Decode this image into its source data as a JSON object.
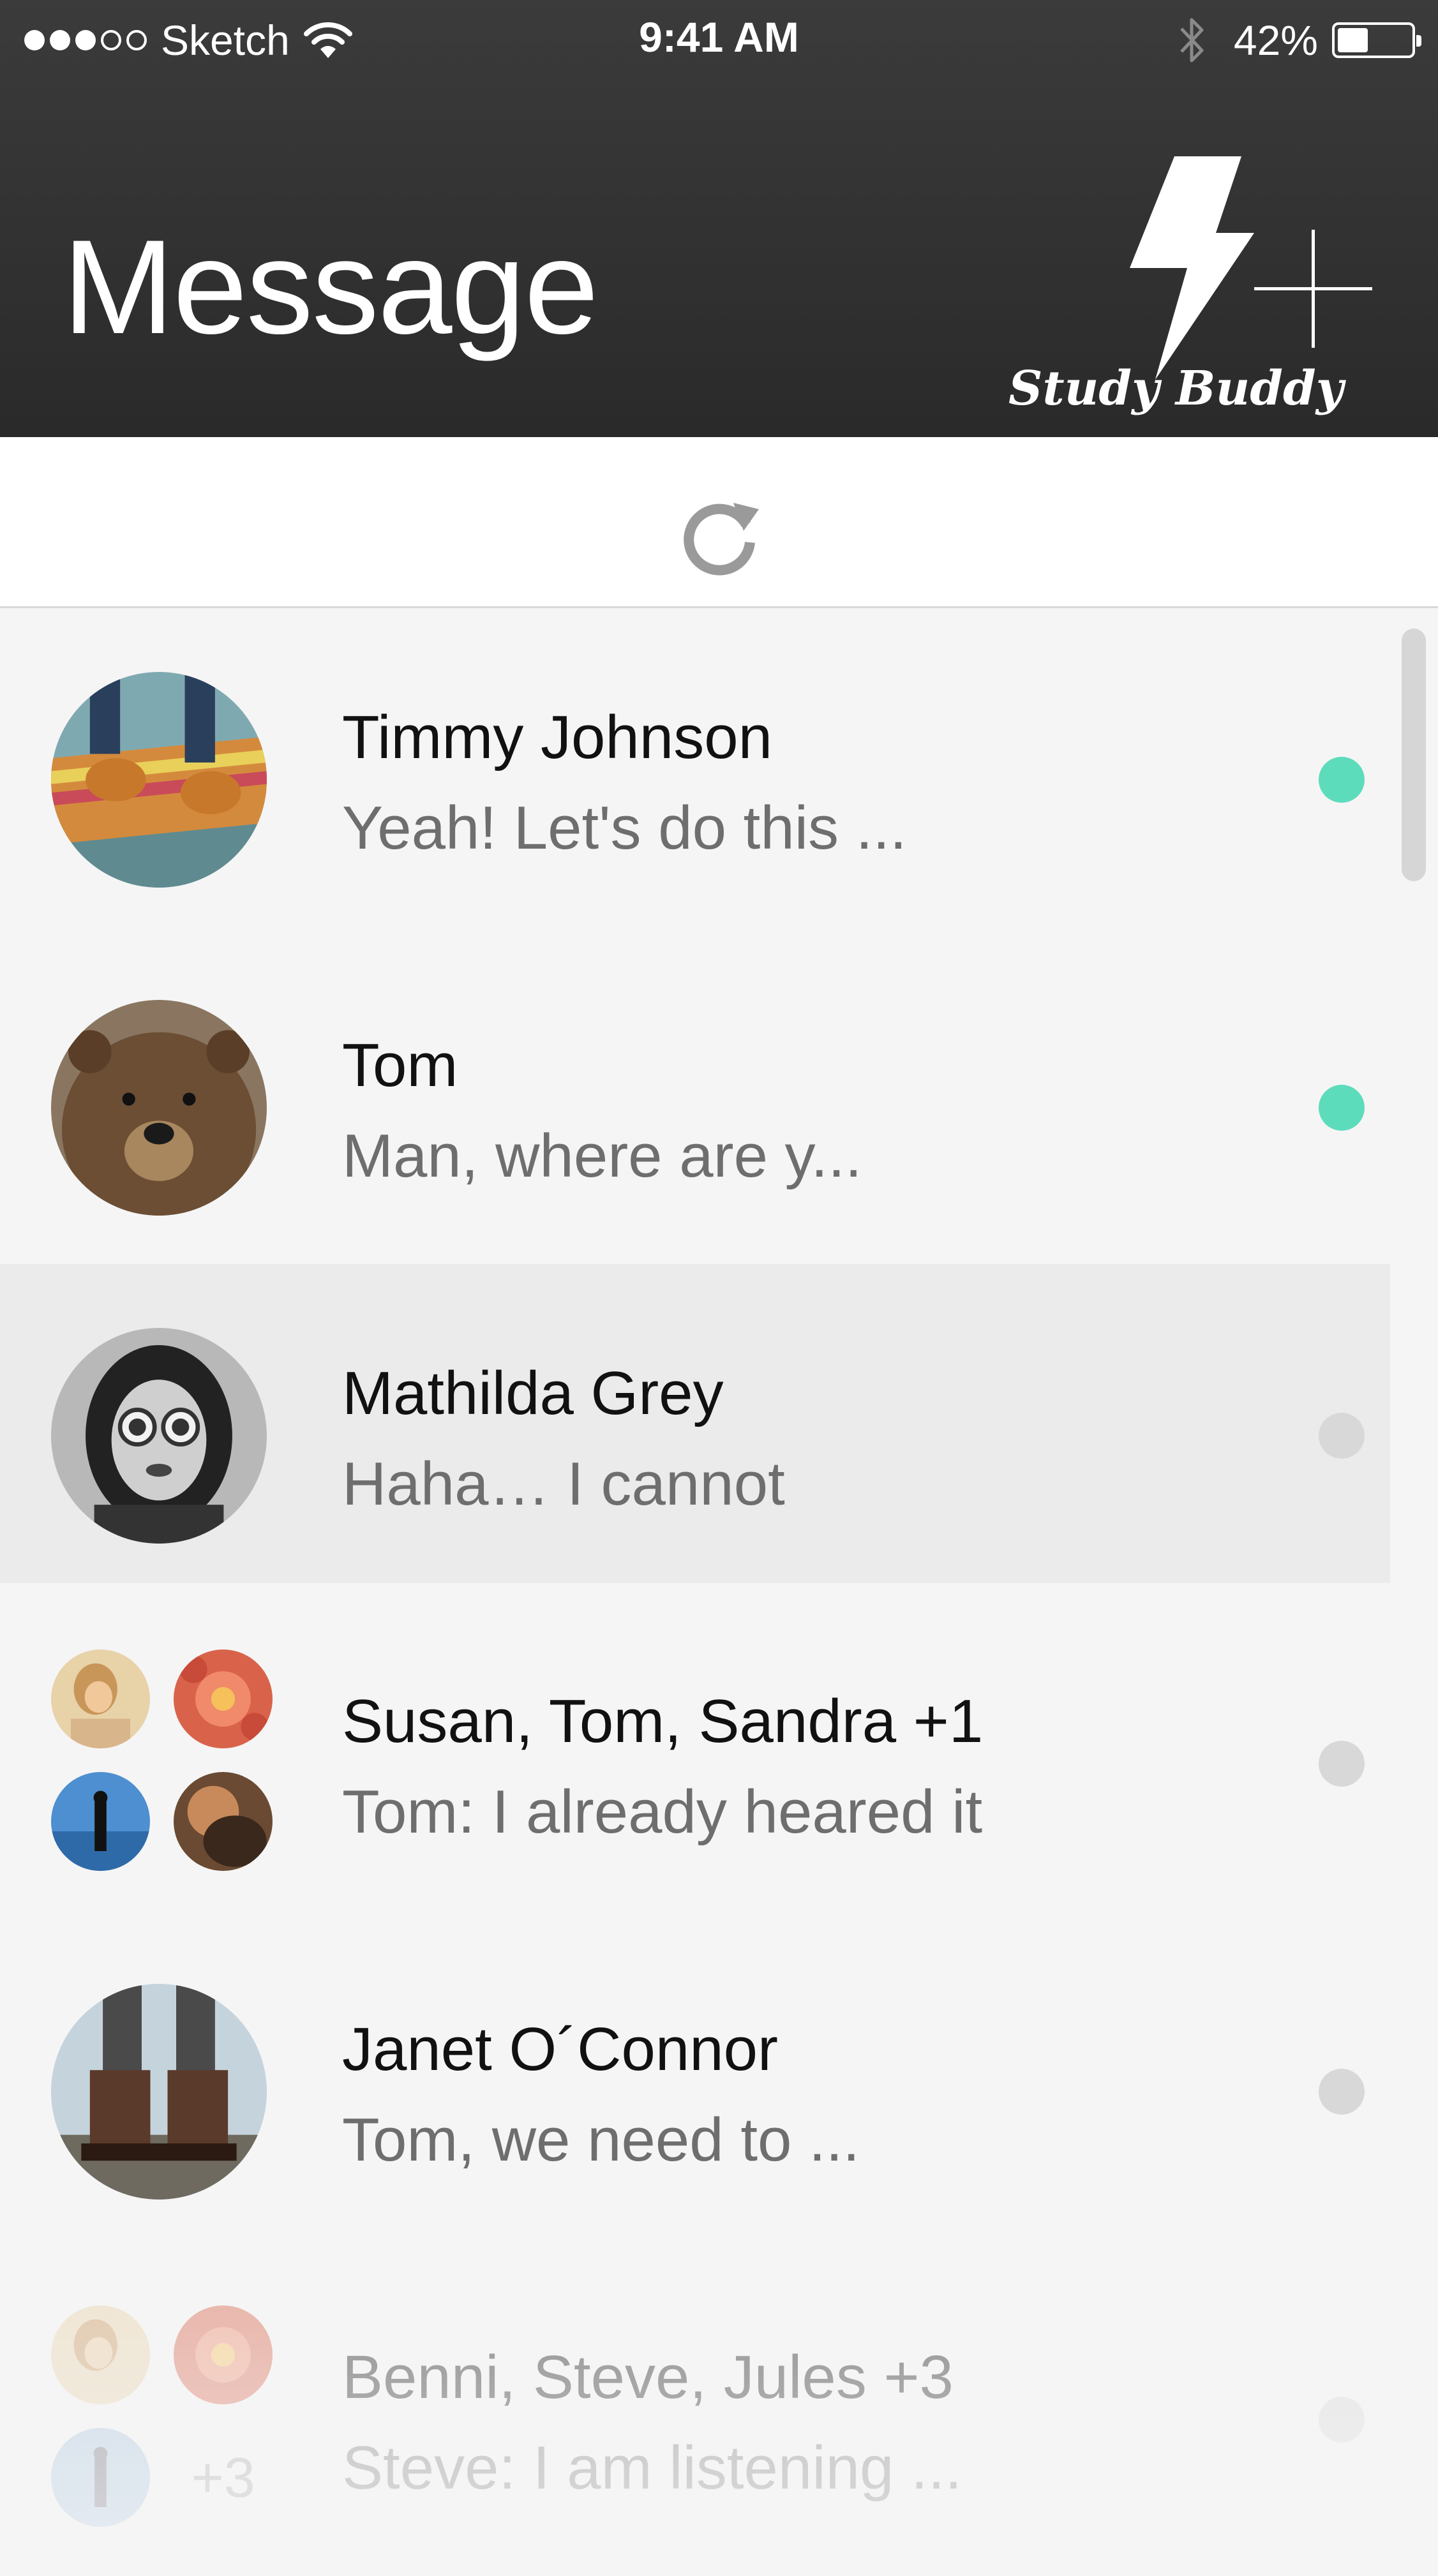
{
  "status_bar": {
    "carrier": "Sketch",
    "time": "9:41 AM",
    "battery_percent": "42%",
    "battery_level": 0.42,
    "signal_filled": 3,
    "signal_total": 5
  },
  "header": {
    "title": "Message",
    "brand": "Study Buddy",
    "brand_icon": "lightning-bolt-icon",
    "add_icon": "plus-icon"
  },
  "refresh": {
    "icon": "refresh-icon"
  },
  "colors": {
    "online": "#5ddcbb",
    "offline": "#d8d8d8",
    "header_bg": "#2f2f2f",
    "list_bg": "#f5f5f5",
    "selected_bg": "#ebebeb"
  },
  "conversations": [
    {
      "name": "Timmy Johnson",
      "preview": "Yeah! Let's do this ...",
      "online": true,
      "avatar": "sneakers-on-skateboard"
    },
    {
      "name": "Tom",
      "preview": "Man, where are y...",
      "online": true,
      "avatar": "bear"
    },
    {
      "name": "Mathilda Grey",
      "preview": "Haha… I cannot",
      "online": false,
      "selected": true,
      "avatar": "woman-with-sunglasses"
    },
    {
      "name": "Susan, Tom, Sandra +1",
      "preview": "Tom: I already heared it",
      "online": false,
      "group": true
    },
    {
      "name": "Janet O´Connor",
      "preview": "Tom, we need to ...",
      "online": false,
      "avatar": "hiking-boots"
    },
    {
      "name": "Benni, Steve, Jules +3",
      "preview": "Steve: I am listening ...",
      "online": false,
      "group": true,
      "extra_count": "+3"
    }
  ]
}
